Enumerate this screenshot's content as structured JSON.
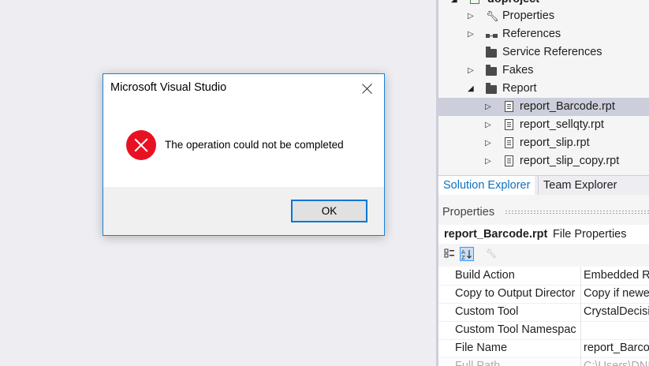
{
  "dialog": {
    "title": "Microsoft Visual Studio",
    "message": "The operation could not be completed",
    "ok_label": "OK"
  },
  "solution_tree": {
    "project": "doproject",
    "items": [
      {
        "label": "Properties",
        "icon": "wrench-icon",
        "expanded": false
      },
      {
        "label": "References",
        "icon": "references-icon",
        "expanded": false
      },
      {
        "label": "Service References",
        "icon": "folder-icon",
        "expanded": null
      },
      {
        "label": "Fakes",
        "icon": "folder-icon",
        "expanded": false
      },
      {
        "label": "Report",
        "icon": "folder-open-icon",
        "expanded": true
      },
      {
        "label": "report_Barcode.rpt",
        "icon": "report-file-icon",
        "expanded": false,
        "selected": true
      },
      {
        "label": "report_sellqty.rpt",
        "icon": "report-file-icon",
        "expanded": false
      },
      {
        "label": "report_slip.rpt",
        "icon": "report-file-icon",
        "expanded": false
      },
      {
        "label": "report_slip_copy.rpt",
        "icon": "report-file-icon",
        "expanded": false
      }
    ]
  },
  "tabs": [
    {
      "label": "Solution Explorer",
      "active": true
    },
    {
      "label": "Team Explorer",
      "active": false
    }
  ],
  "properties": {
    "header": "Properties",
    "selected_name": "report_Barcode.rpt",
    "selected_type": "File Properties",
    "rows": [
      {
        "name": "Build Action",
        "value": "Embedded R"
      },
      {
        "name": "Copy to Output Director",
        "value": "Copy if newe"
      },
      {
        "name": "Custom Tool",
        "value": "CrystalDecisi"
      },
      {
        "name": "Custom Tool Namespac",
        "value": ""
      },
      {
        "name": "File Name",
        "value": "report_Barco"
      },
      {
        "name": "Full Path",
        "value": "C:\\Users\\DNI"
      }
    ]
  }
}
